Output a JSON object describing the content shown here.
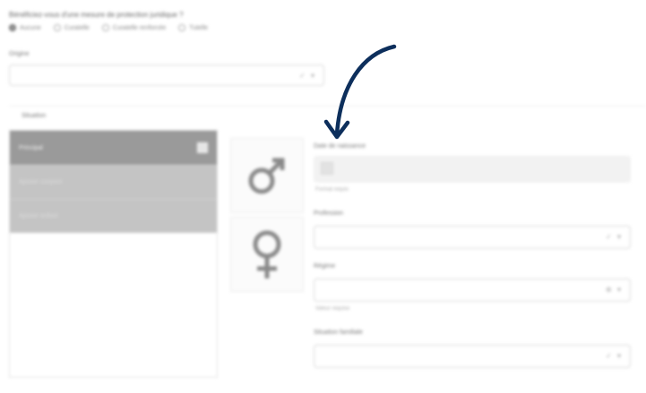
{
  "form": {
    "question": "Bénéficiez-vous d'une mesure de protection juridique ?",
    "options": [
      {
        "label": "Aucune",
        "selected": true
      },
      {
        "label": "Curatelle",
        "selected": false
      },
      {
        "label": "Curatelle renforcée",
        "selected": false
      },
      {
        "label": "Tutelle",
        "selected": false
      }
    ],
    "origine_label": "Origine",
    "origine_value": "",
    "situation_title": "Situation"
  },
  "sidebar": {
    "items": [
      {
        "label": "Principal"
      },
      {
        "label": "Ajouter conjoint"
      },
      {
        "label": "Ajouter enfant"
      }
    ]
  },
  "gender": {
    "male_icon": "male-symbol-icon",
    "female_icon": "female-symbol-icon"
  },
  "fields": {
    "date_label": "Date de naissance",
    "date_hint": "Format requis",
    "profession_label": "Profession",
    "regime_label": "Régime",
    "regime_hint": "Valeur requise",
    "situation_familiale_label": "Situation familiale"
  },
  "colors": {
    "arrow": "#0d2f5c",
    "active_item": "#9a9a9a"
  }
}
